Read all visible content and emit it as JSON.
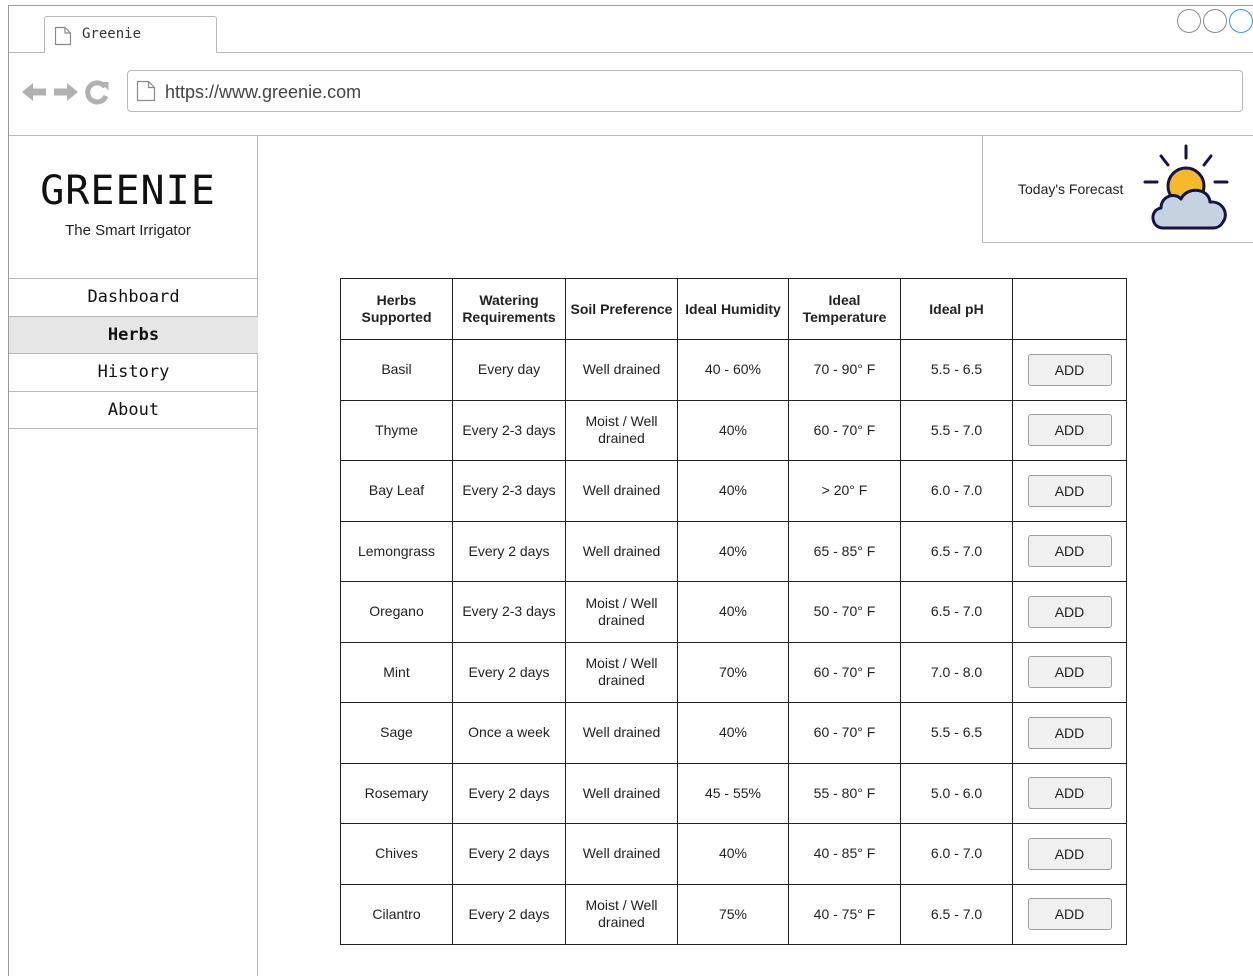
{
  "browser": {
    "tab_title": "Greenie",
    "url": "https://www.greenie.com"
  },
  "sidebar": {
    "brand": "GREENIE",
    "tagline": "The Smart Irrigator",
    "items": [
      {
        "label": "Dashboard",
        "active": false
      },
      {
        "label": "Herbs",
        "active": true
      },
      {
        "label": "History",
        "active": false
      },
      {
        "label": "About",
        "active": false
      }
    ]
  },
  "forecast": {
    "label": "Today's Forecast",
    "icon": "sun-behind-cloud-icon"
  },
  "table": {
    "headers": [
      "Herbs Supported",
      "Watering Requirements",
      "Soil Preference",
      "Ideal Humidity",
      "Ideal Temperature",
      "Ideal pH",
      ""
    ],
    "add_label": "ADD",
    "rows": [
      {
        "herb": "Basil",
        "watering": "Every day",
        "soil": "Well drained",
        "humidity": "40 - 60%",
        "temperature": "70 - 90° F",
        "ph": "5.5 - 6.5"
      },
      {
        "herb": "Thyme",
        "watering": "Every 2-3 days",
        "soil": "Moist / Well drained",
        "humidity": "40%",
        "temperature": "60 - 70° F",
        "ph": "5.5 - 7.0"
      },
      {
        "herb": "Bay Leaf",
        "watering": "Every 2-3 days",
        "soil": "Well drained",
        "humidity": "40%",
        "temperature": "> 20° F",
        "ph": "6.0 - 7.0"
      },
      {
        "herb": "Lemongrass",
        "watering": "Every 2 days",
        "soil": "Well drained",
        "humidity": "40%",
        "temperature": "65 - 85° F",
        "ph": "6.5 - 7.0"
      },
      {
        "herb": "Oregano",
        "watering": "Every 2-3 days",
        "soil": "Moist / Well drained",
        "humidity": "40%",
        "temperature": "50 - 70° F",
        "ph": "6.5 - 7.0"
      },
      {
        "herb": "Mint",
        "watering": "Every 2 days",
        "soil": "Moist / Well drained",
        "humidity": "70%",
        "temperature": "60 - 70° F",
        "ph": "7.0 - 8.0"
      },
      {
        "herb": "Sage",
        "watering": "Once a week",
        "soil": "Well drained",
        "humidity": "40%",
        "temperature": "60 - 70° F",
        "ph": "5.5 - 6.5"
      },
      {
        "herb": "Rosemary",
        "watering": "Every 2 days",
        "soil": "Well drained",
        "humidity": "45 - 55%",
        "temperature": "55 - 80° F",
        "ph": "5.0 - 6.0"
      },
      {
        "herb": "Chives",
        "watering": "Every 2 days",
        "soil": "Well drained",
        "humidity": "40%",
        "temperature": "40 - 85° F",
        "ph": "6.0 - 7.0"
      },
      {
        "herb": "Cilantro",
        "watering": "Every 2 days",
        "soil": "Moist / Well drained",
        "humidity": "75%",
        "temperature": "40 - 75° F",
        "ph": "6.5 - 7.0"
      }
    ]
  },
  "colors": {
    "border": "#b8b8b8",
    "active_nav_bg": "#e6e6e6",
    "button_bg": "#f0f0f0",
    "sun": "#f5b82e",
    "cloud": "#c5d3e0",
    "icon_outline": "#13134a"
  }
}
